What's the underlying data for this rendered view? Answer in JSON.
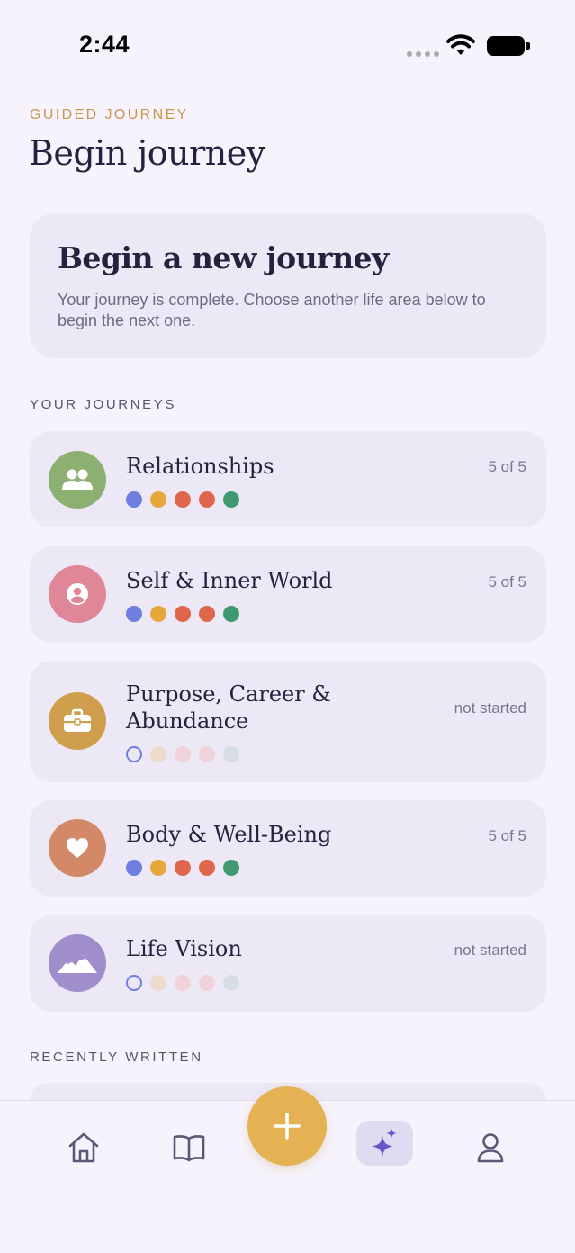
{
  "status_bar": {
    "time": "2:44"
  },
  "header": {
    "eyebrow": "GUIDED JOURNEY",
    "title": "Begin journey"
  },
  "hero": {
    "title": "Begin a new journey",
    "text": "Your journey is complete. Choose another life area below to begin the next one."
  },
  "journeys_label": "YOUR JOURNEYS",
  "journeys": [
    {
      "title": "Relationships",
      "status": "5 of 5",
      "icon": "people-icon",
      "color": "#8BB071",
      "completed": 5
    },
    {
      "title": "Self & Inner World",
      "status": "5 of 5",
      "icon": "person-circle-icon",
      "color": "#DF8797",
      "completed": 5
    },
    {
      "title": "Purpose, Career & Abundance",
      "status": "not started",
      "icon": "briefcase-icon",
      "color": "#CF9E4C",
      "completed": 0
    },
    {
      "title": "Body & Well-Being",
      "status": "5 of 5",
      "icon": "heart-icon",
      "color": "#D38867",
      "completed": 5
    },
    {
      "title": "Life Vision",
      "status": "not started",
      "icon": "mountains-icon",
      "color": "#A08DCB",
      "completed": 0
    }
  ],
  "dot_colors": [
    "#6E7FE0",
    "#E6A83A",
    "#E0664B",
    "#E0664B",
    "#3F9A72"
  ],
  "dot_colors_faded": [
    "#EDDCCB",
    "#EFD3D8",
    "#EFD3D8",
    "#D6DEE4"
  ],
  "recent_label": "RECENTLY WRITTEN",
  "tabs": [
    {
      "name": "home-icon",
      "active": false
    },
    {
      "name": "book-icon",
      "active": false
    },
    {
      "name": "plus-icon",
      "active": false
    },
    {
      "name": "sparkles-icon",
      "active": true
    },
    {
      "name": "profile-icon",
      "active": false
    }
  ],
  "colors": {
    "accent": "#E4B253",
    "eyebrow": "#C9954B",
    "active_tab": "#6A55C7"
  }
}
